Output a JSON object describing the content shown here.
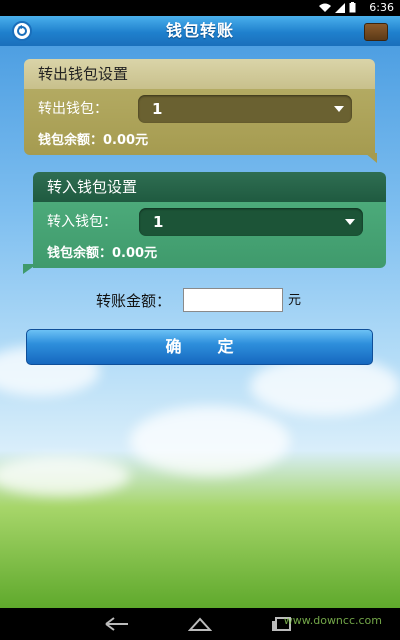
{
  "status_bar": {
    "time": "6:36"
  },
  "title_bar": {
    "title": "钱包转账"
  },
  "transfer_out": {
    "heading": "转出钱包设置",
    "wallet_label": "转出钱包：",
    "wallet_value": "1",
    "balance_label": "钱包余额：",
    "balance_value": "0.00元"
  },
  "transfer_in": {
    "heading": "转入钱包设置",
    "wallet_label": "转入钱包：",
    "wallet_value": "1",
    "balance_label": "钱包余额：",
    "balance_value": "0.00元"
  },
  "amount": {
    "label": "转账金额：",
    "value": "",
    "unit": "元"
  },
  "confirm_label": "确定",
  "watermark": "www.downcc.com",
  "colors": {
    "title_bar": "#1f80cd",
    "out_panel": "#a59b50",
    "in_panel": "#3f9a6c",
    "confirm_button": "#2e8fdc"
  }
}
